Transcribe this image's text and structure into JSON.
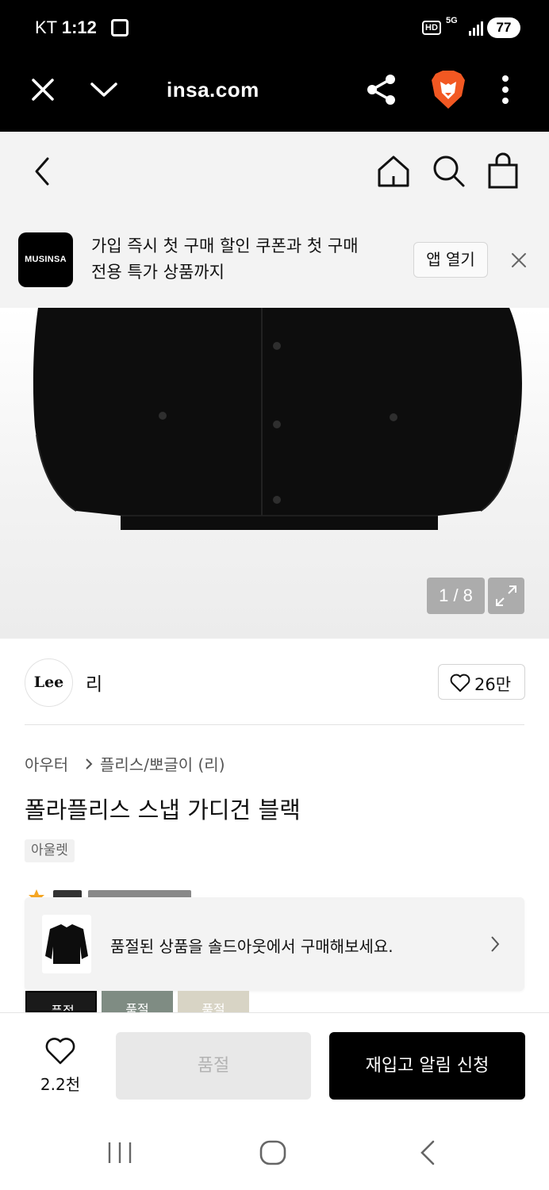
{
  "status_bar": {
    "carrier": "KT",
    "time": "1:12",
    "network": "5G",
    "hd": "HD",
    "battery": "77"
  },
  "browser": {
    "url": "insa.com",
    "icons": [
      "close-icon",
      "chevron-down-icon",
      "share-icon",
      "brave-lion-icon",
      "more-vertical-icon"
    ]
  },
  "site_header": {
    "icons": [
      "back-icon",
      "home-icon",
      "search-icon",
      "shopping-bag-icon"
    ]
  },
  "app_banner": {
    "logo_text": "MUSINSA",
    "message_line1": "가입 즉시 첫 구매 할인 쿠폰과 첫 구매",
    "message_line2": "전용 특가 상품까지",
    "open_app_label": "앱 열기"
  },
  "gallery": {
    "counter": "1 / 8"
  },
  "brand": {
    "logo_text": "Lee",
    "name": "리",
    "likes": "26만"
  },
  "product": {
    "category": "아우터",
    "subcategory": "플리스/뽀글이 (리)",
    "title": "폴라플리스 스냅 가디건 블랙",
    "tag": "아울렛"
  },
  "soldout_popup": {
    "message": "품절된 상품을 솔드아웃에서 구매해보세요."
  },
  "swatches": [
    {
      "label": "품절",
      "color": "#1a1a1a"
    },
    {
      "label": "품절",
      "color": "#7f8c83"
    },
    {
      "label": "품절",
      "color": "#d8d4c5"
    }
  ],
  "bottom_bar": {
    "wish_count": "2.2천",
    "soldout_label": "품절",
    "restock_label": "재입고 알림 신청"
  },
  "colors": {
    "accent_black": "#000000",
    "banner_bg": "#f3f3f3",
    "disabled_bg": "#e8e8e8"
  }
}
